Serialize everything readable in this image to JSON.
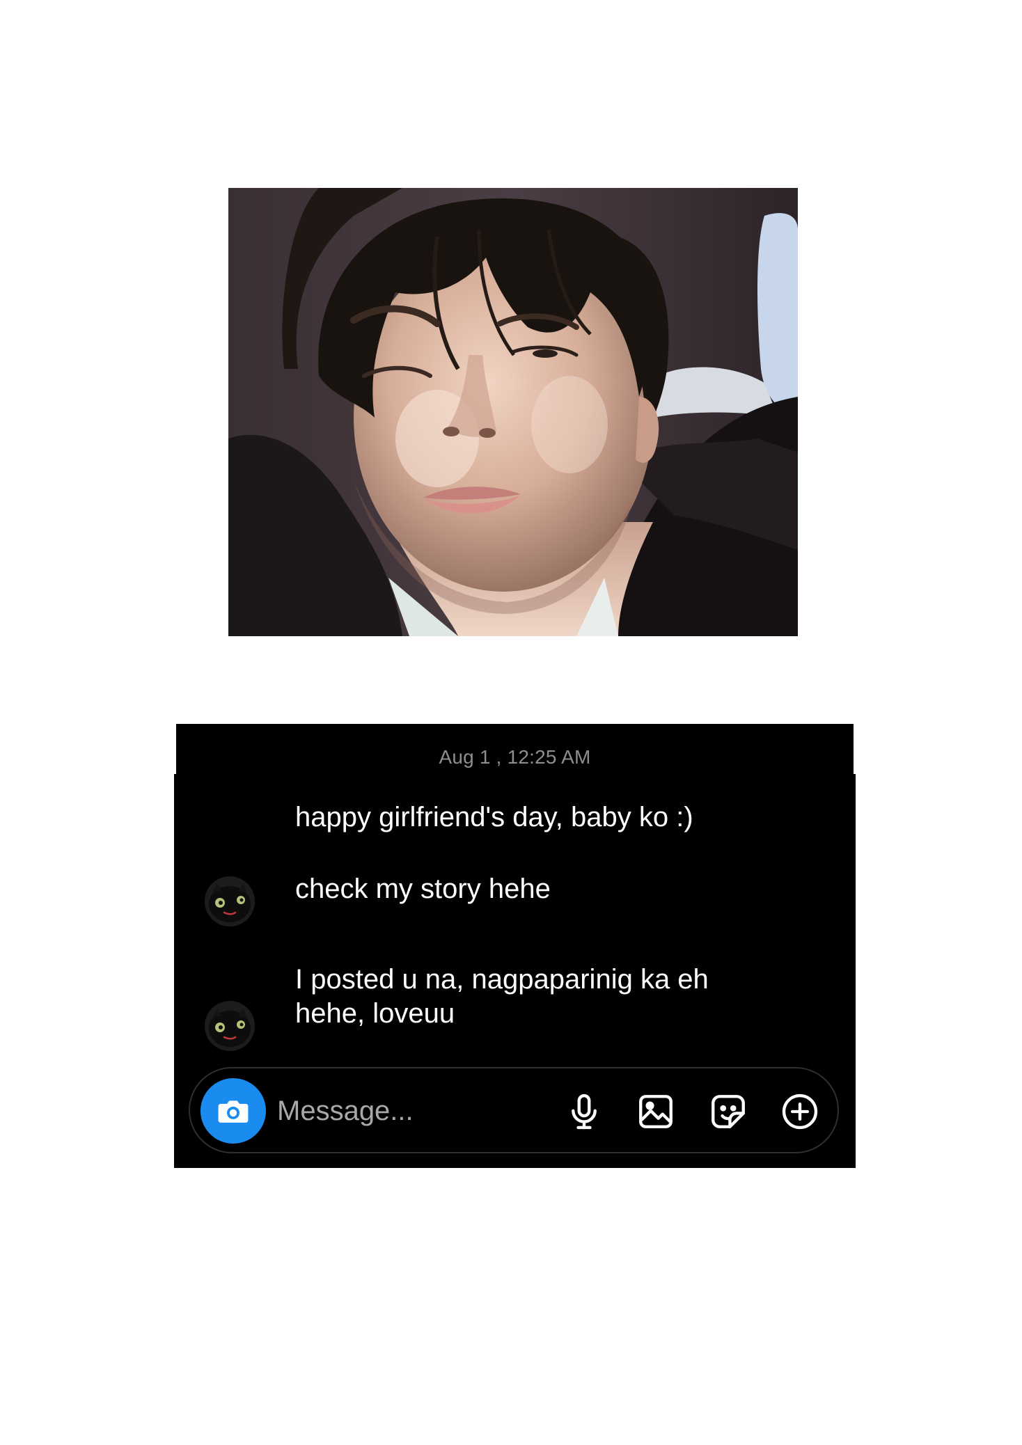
{
  "chat": {
    "timestamp": "Aug 1 , 12:25 AM",
    "messages": [
      {
        "text": "happy girlfriend's day, baby ko :)",
        "show_avatar": false
      },
      {
        "text": "check my story hehe",
        "show_avatar": true
      },
      {
        "text": "I posted u na, nagpaparinig ka eh\nhehe, loveuu",
        "show_avatar": true
      }
    ],
    "composer": {
      "placeholder": "Message...",
      "icons": [
        "camera-icon",
        "microphone-icon",
        "gallery-icon",
        "sticker-icon",
        "plus-icon"
      ]
    }
  },
  "colors": {
    "chat_background": "#000000",
    "message_text": "#ffffff",
    "timestamp_text": "#8e8e8e",
    "camera_button": "#1a8cf0",
    "composer_border": "#2f2f2f"
  }
}
